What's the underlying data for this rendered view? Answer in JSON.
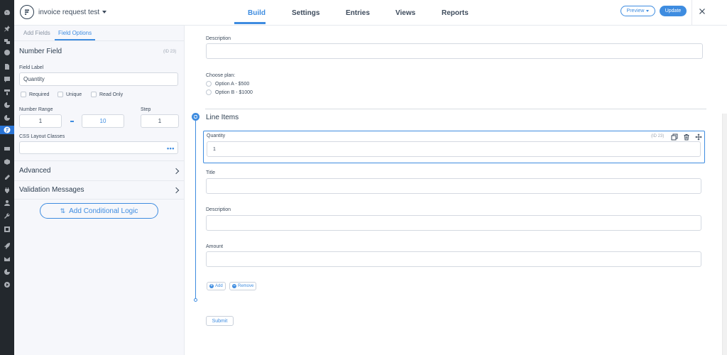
{
  "header": {
    "form_title": "invoice request test",
    "tabs": [
      {
        "label": "Build"
      },
      {
        "label": "Settings"
      },
      {
        "label": "Entries"
      },
      {
        "label": "Views"
      },
      {
        "label": "Reports"
      }
    ],
    "active_tab": "Build",
    "preview_label": "Preview",
    "update_label": "Update"
  },
  "left_panel": {
    "subtabs": [
      "Add Fields",
      "Field Options"
    ],
    "active_subtab": "Field Options",
    "field_type": "Number Field",
    "field_id": "(ID 23)",
    "field_label_label": "Field Label",
    "field_label_value": "Quantity",
    "checkboxes": [
      "Required",
      "Unique",
      "Read Only"
    ],
    "number_range_label": "Number Range",
    "range_min": "1",
    "range_max": "10",
    "step_label": "Step",
    "step_value": "1",
    "css_label": "CSS Layout Classes",
    "css_value": "",
    "more_icon": "•••",
    "advanced_label": "Advanced",
    "validation_label": "Validation Messages",
    "conditional_logic_label": "Add Conditional Logic"
  },
  "form": {
    "description_label": "Description",
    "choose_plan_label": "Choose plan:",
    "plan_options": [
      "Option A - $500",
      "Option B - $1000"
    ],
    "section_title": "Line Items",
    "selected_field": {
      "label": "Quantity",
      "id": "(ID 23)",
      "value": "1"
    },
    "repeater_fields": [
      {
        "label": "Title",
        "value": ""
      },
      {
        "label": "Description",
        "value": ""
      },
      {
        "label": "Amount",
        "value": ""
      }
    ],
    "add_label": "Add",
    "remove_label": "Remove",
    "submit_label": "Submit"
  },
  "colors": {
    "accent": "#3e8ce0",
    "wp_sidebar": "#23282d",
    "panel_bg": "#f6f7fb"
  }
}
